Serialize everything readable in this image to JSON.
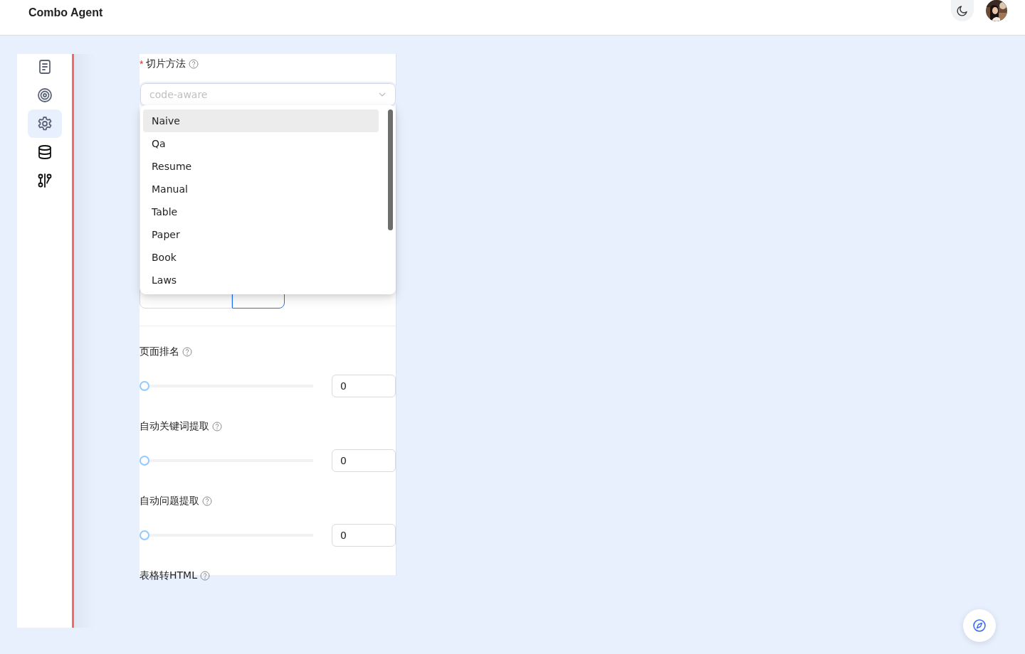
{
  "header": {
    "title": "Combo Agent"
  },
  "sidebar": {
    "items": [
      {
        "kind": "document",
        "selected": false
      },
      {
        "kind": "target",
        "selected": false
      },
      {
        "kind": "gear",
        "selected": true
      },
      {
        "kind": "database",
        "selected": false
      },
      {
        "kind": "flow",
        "selected": false
      }
    ]
  },
  "form": {
    "chunk_method": {
      "label": "切片方法",
      "required_mark": "*",
      "placeholder": "code-aware",
      "options": [
        {
          "label": "Naive",
          "selected": true
        },
        {
          "label": "Qa",
          "selected": false
        },
        {
          "label": "Resume",
          "selected": false
        },
        {
          "label": "Manual",
          "selected": false
        },
        {
          "label": "Table",
          "selected": false
        },
        {
          "label": "Paper",
          "selected": false
        },
        {
          "label": "Book",
          "selected": false
        },
        {
          "label": "Laws",
          "selected": false
        }
      ]
    },
    "index_mode": {
      "options": [
        {
          "selected": false
        },
        {
          "selected": true
        }
      ]
    },
    "sliders": [
      {
        "label": "页面排名",
        "level": 0,
        "value": "0"
      },
      {
        "label": "自动关键词提取",
        "level": 0,
        "value": "0"
      },
      {
        "label": "自动问题提取",
        "level": 0,
        "value": "0"
      }
    ],
    "table_to_html": {
      "label": "表格转HTML"
    }
  }
}
